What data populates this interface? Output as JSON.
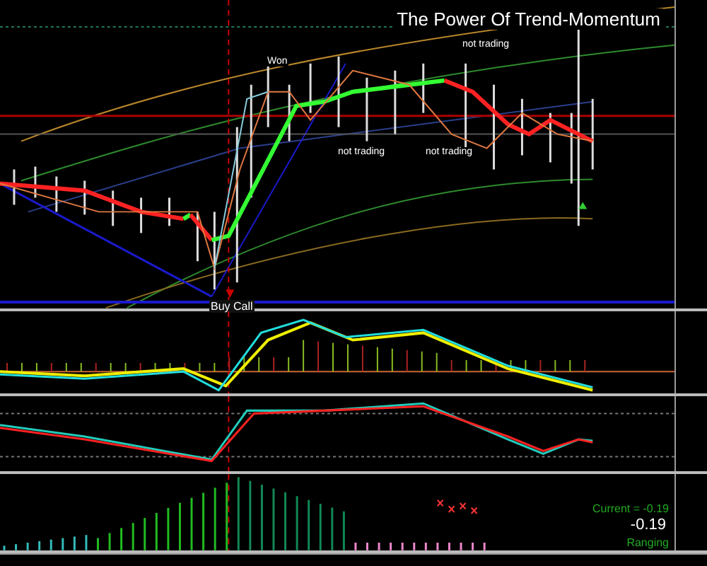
{
  "chart": {
    "title": "The Power Of Trend-Momentum",
    "annotations": [
      {
        "kind": "label",
        "text": "Won"
      },
      {
        "kind": "label",
        "text": "not trading"
      },
      {
        "kind": "label",
        "text": "not trading"
      },
      {
        "kind": "label",
        "text": "not trading"
      },
      {
        "kind": "signal",
        "text": "Buy Call"
      }
    ]
  },
  "trend_panel": {
    "current": "Current = -0.19",
    "value": "-0.19",
    "state": "Ranging"
  }
}
